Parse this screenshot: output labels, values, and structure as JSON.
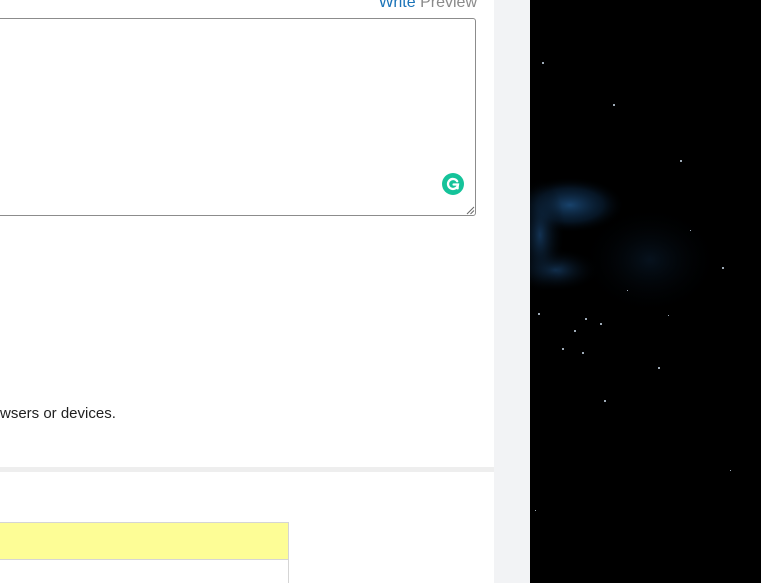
{
  "editor": {
    "tabs": {
      "write_label": "Write",
      "separator": " ",
      "preview_label": "Preview"
    },
    "textarea_value": "",
    "grammarly_icon": "grammarly-icon"
  },
  "note_text": "wsers or devices.",
  "table": {
    "header_highlight_color": "#fdfd96"
  },
  "colors": {
    "accent_link": "#1a73b8",
    "grammarly_green": "#15c39a",
    "space_background": "#000000"
  }
}
